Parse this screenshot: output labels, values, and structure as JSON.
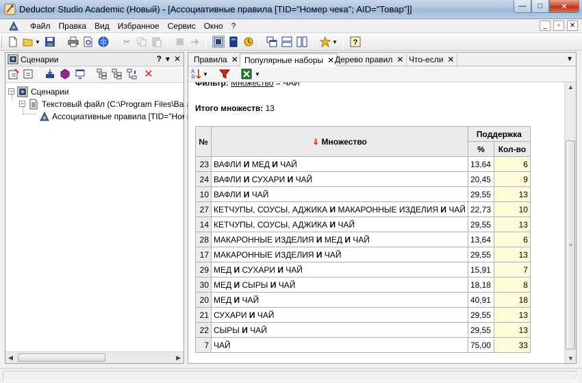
{
  "window": {
    "title": "Deductor Studio Academic (Новый) - [Ассоциативные правила [TID=\"Номер чека\"; AID=\"Товар\"]]",
    "min_glyph": "—",
    "max_glyph": "□",
    "close_glyph": "✕"
  },
  "menu": {
    "items": [
      "Файл",
      "Правка",
      "Вид",
      "Избранное",
      "Сервис",
      "Окно",
      "?"
    ],
    "mdi_buttons": [
      "_",
      "▫",
      "✕"
    ]
  },
  "left_panel": {
    "title": "Сценарии",
    "header_buttons": [
      "?",
      "▾",
      "✕"
    ],
    "tree": [
      {
        "label": "Сценарии",
        "expander": "−"
      },
      {
        "label": "Текстовый файл (C:\\Program Files\\BaseG",
        "expander": "−"
      },
      {
        "label": "Ассоциативные правила [TID=\"Номер"
      }
    ]
  },
  "tabs": [
    {
      "label": "Правила",
      "close": "✕",
      "active": false
    },
    {
      "label": "Популярные наборы",
      "close": "✕",
      "active": true
    },
    {
      "label": "Дерево правил",
      "close": "✕",
      "active": false
    },
    {
      "label": "Что-если",
      "close": "✕",
      "active": false
    }
  ],
  "content": {
    "filter_label": "Фильтр:",
    "filter_link": "Множество",
    "filter_value": " = ЧАЙ",
    "total_label": "Итого множеств:",
    "total_value": "13",
    "table": {
      "col_num": "№",
      "col_set": "Множество",
      "sort_glyph": "⇓",
      "col_support": "Поддержка",
      "col_pct": "%",
      "col_count": "Кол-во",
      "conj": "И",
      "rows": [
        {
          "num": "23",
          "items": [
            "ВАФЛИ",
            "МЕД",
            "ЧАЙ"
          ],
          "pct": "13,64",
          "count": "6"
        },
        {
          "num": "24",
          "items": [
            "ВАФЛИ",
            "СУХАРИ",
            "ЧАЙ"
          ],
          "pct": "20,45",
          "count": "9"
        },
        {
          "num": "10",
          "items": [
            "ВАФЛИ",
            "ЧАЙ"
          ],
          "pct": "29,55",
          "count": "13"
        },
        {
          "num": "27",
          "items": [
            "КЕТЧУПЫ, СОУСЫ, АДЖИКА",
            "МАКАРОННЫЕ ИЗДЕЛИЯ",
            "ЧАЙ"
          ],
          "pct": "22,73",
          "count": "10"
        },
        {
          "num": "14",
          "items": [
            "КЕТЧУПЫ, СОУСЫ, АДЖИКА",
            "ЧАЙ"
          ],
          "pct": "29,55",
          "count": "13"
        },
        {
          "num": "28",
          "items": [
            "МАКАРОННЫЕ ИЗДЕЛИЯ",
            "МЕД",
            "ЧАЙ"
          ],
          "pct": "13,64",
          "count": "6"
        },
        {
          "num": "17",
          "items": [
            "МАКАРОННЫЕ ИЗДЕЛИЯ",
            "ЧАЙ"
          ],
          "pct": "29,55",
          "count": "13"
        },
        {
          "num": "29",
          "items": [
            "МЕД",
            "СУХАРИ",
            "ЧАЙ"
          ],
          "pct": "15,91",
          "count": "7"
        },
        {
          "num": "30",
          "items": [
            "МЕД",
            "СЫРЫ",
            "ЧАЙ"
          ],
          "pct": "18,18",
          "count": "8"
        },
        {
          "num": "20",
          "items": [
            "МЕД",
            "ЧАЙ"
          ],
          "pct": "40,91",
          "count": "18"
        },
        {
          "num": "21",
          "items": [
            "СУХАРИ",
            "ЧАЙ"
          ],
          "pct": "29,55",
          "count": "13"
        },
        {
          "num": "22",
          "items": [
            "СЫРЫ",
            "ЧАЙ"
          ],
          "pct": "29,55",
          "count": "13"
        },
        {
          "num": "7",
          "items": [
            "ЧАЙ"
          ],
          "pct": "75,00",
          "count": "33"
        }
      ]
    }
  },
  "colors": {
    "header_bg": "#ebebeb",
    "count_bg": "#fdfbd8",
    "sort_arrow": "#d40000",
    "delete_icon": "#e02020"
  }
}
